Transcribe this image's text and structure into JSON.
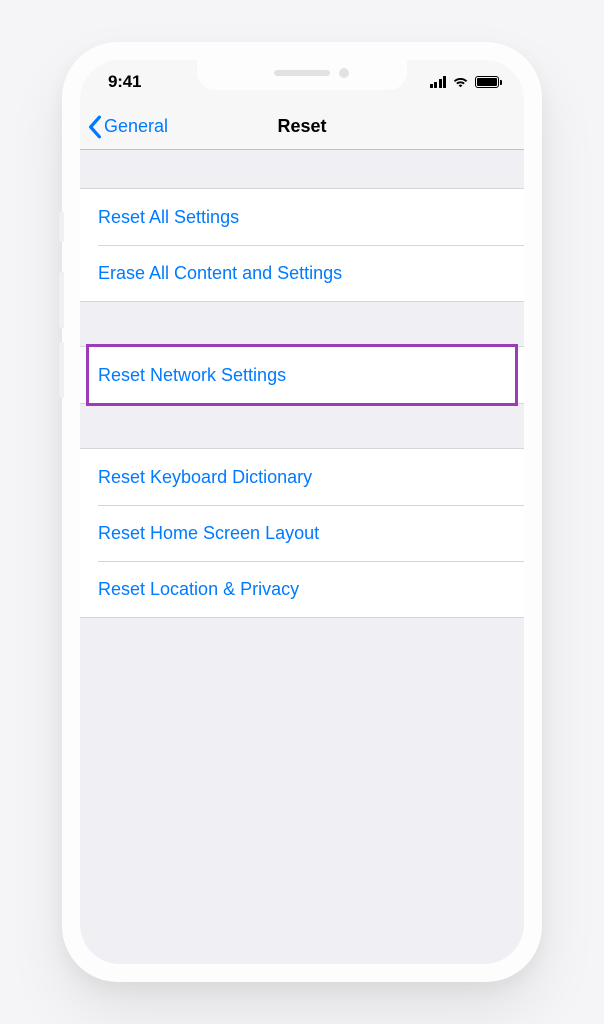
{
  "status": {
    "time": "9:41"
  },
  "nav": {
    "back_label": "General",
    "title": "Reset"
  },
  "groups": {
    "g1": {
      "items": [
        {
          "label": "Reset All Settings"
        },
        {
          "label": "Erase All Content and Settings"
        }
      ]
    },
    "g2": {
      "items": [
        {
          "label": "Reset Network Settings"
        }
      ]
    },
    "g3": {
      "items": [
        {
          "label": "Reset Keyboard Dictionary"
        },
        {
          "label": "Reset Home Screen Layout"
        },
        {
          "label": "Reset Location & Privacy"
        }
      ]
    }
  },
  "highlight_color": "#9d3db5",
  "accent_color": "#007aff"
}
